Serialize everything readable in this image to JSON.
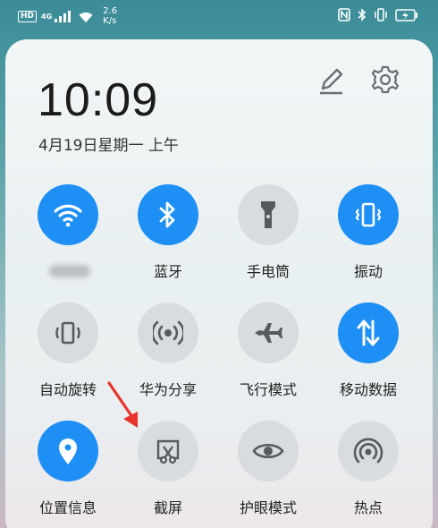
{
  "status_bar": {
    "hd": "HD",
    "network": "4G",
    "speed_value": "2.6",
    "speed_unit": "K/s"
  },
  "clock": {
    "time": "10:09",
    "date": "4月19日星期一 上午"
  },
  "header": {
    "edit_icon": "pencil-icon",
    "settings_icon": "gear-icon"
  },
  "tiles": [
    {
      "label": "",
      "icon": "wifi-icon",
      "state": "on"
    },
    {
      "label": "蓝牙",
      "icon": "bluetooth-icon",
      "state": "on"
    },
    {
      "label": "手电筒",
      "icon": "flashlight-icon",
      "state": "off"
    },
    {
      "label": "振动",
      "icon": "vibrate-icon",
      "state": "on"
    },
    {
      "label": "自动旋转",
      "icon": "auto-rotate-icon",
      "state": "off"
    },
    {
      "label": "华为分享",
      "icon": "share-icon",
      "state": "off"
    },
    {
      "label": "飞行模式",
      "icon": "airplane-icon",
      "state": "off"
    },
    {
      "label": "移动数据",
      "icon": "mobile-data-icon",
      "state": "on"
    },
    {
      "label": "位置信息",
      "icon": "location-icon",
      "state": "on"
    },
    {
      "label": "截屏",
      "icon": "screenshot-icon",
      "state": "off"
    },
    {
      "label": "护眼模式",
      "icon": "eye-icon",
      "state": "off"
    },
    {
      "label": "热点",
      "icon": "hotspot-icon",
      "state": "off"
    }
  ],
  "colors": {
    "on": "#1e8ff5",
    "off": "#d9dcde",
    "icon_off": "#555a5e",
    "arrow": "#e8332b"
  }
}
